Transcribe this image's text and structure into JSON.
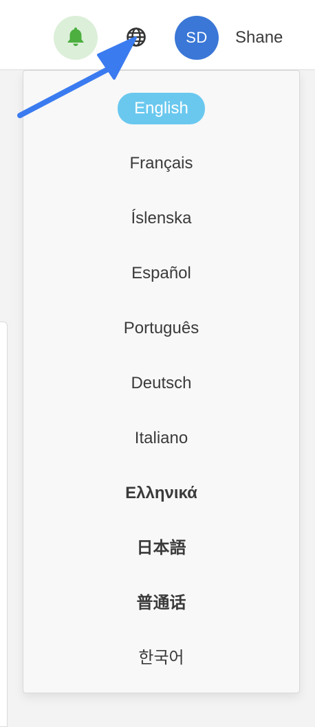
{
  "header": {
    "bell_icon": "bell-icon",
    "globe_icon": "globe-icon",
    "avatar_initials": "SD",
    "user_name": "Shane",
    "colors": {
      "bell_bg": "#dcefd9",
      "bell": "#4caf3f",
      "avatar_bg": "#3a77d6"
    }
  },
  "language_menu": {
    "selected_index": 0,
    "selected_color": "#6ac8ef",
    "items": [
      {
        "label": "English"
      },
      {
        "label": "Français"
      },
      {
        "label": "Íslenska"
      },
      {
        "label": "Español"
      },
      {
        "label": "Português"
      },
      {
        "label": "Deutsch"
      },
      {
        "label": "Italiano"
      },
      {
        "label": "Ελληνικά"
      },
      {
        "label": "日本語"
      },
      {
        "label": "普通话"
      },
      {
        "label": "한국어"
      }
    ]
  },
  "annotation": {
    "arrow_color": "#3b7bf0"
  }
}
